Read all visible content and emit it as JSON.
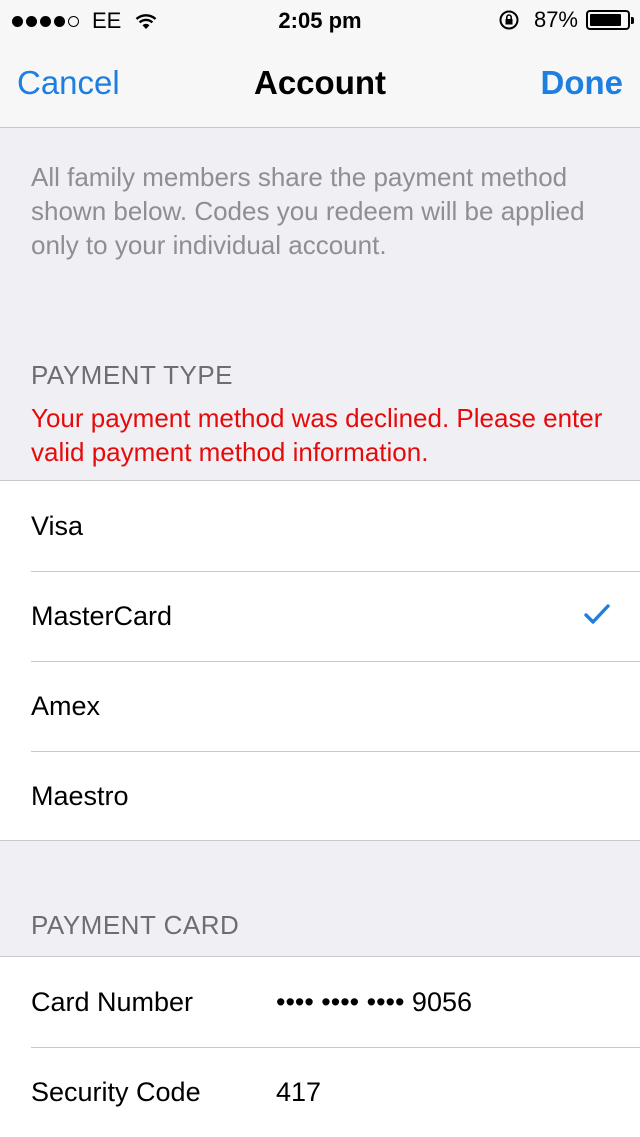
{
  "status_bar": {
    "carrier": "EE",
    "time": "2:05 pm",
    "battery_percent": "87%",
    "battery_level": 0.87
  },
  "nav": {
    "cancel_label": "Cancel",
    "title": "Account",
    "done_label": "Done"
  },
  "info_text": "All family members share the payment method shown below. Codes you redeem will be applied only to your individual account.",
  "payment_type": {
    "header": "PAYMENT TYPE",
    "error": "Your payment method was declined. Please enter valid payment method information.",
    "options": [
      {
        "label": "Visa",
        "selected": false
      },
      {
        "label": "MasterCard",
        "selected": true
      },
      {
        "label": "Amex",
        "selected": false
      },
      {
        "label": "Maestro",
        "selected": false
      }
    ]
  },
  "payment_card": {
    "header": "PAYMENT CARD",
    "card_number_label": "Card Number",
    "card_number_value": "•••• •••• •••• 9056",
    "security_code_label": "Security Code",
    "security_code_value": "417"
  },
  "colors": {
    "accent": "#1e7fe0",
    "error": "#e60b0b",
    "background": "#efeff4"
  }
}
